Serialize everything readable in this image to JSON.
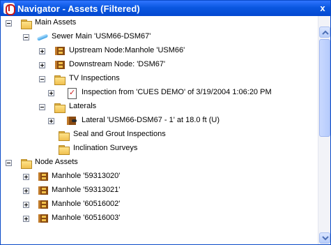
{
  "window": {
    "title": "Navigator - Assets (Filtered)",
    "close_glyph": "x"
  },
  "tree": {
    "main_assets": "Main Assets",
    "sewer_main": "Sewer Main 'USM66-DSM67'",
    "upstream_node": "Upstream Node:Manhole 'USM66'",
    "downstream_node": "Downstream Node: 'DSM67'",
    "tv_inspections": "TV Inspections",
    "inspection_item": "Inspection from 'CUES DEMO' of 3/19/2004 1:06:20 PM",
    "laterals": "Laterals",
    "lateral_item": "Lateral 'USM66-DSM67 - 1' at 18.0 ft (U)",
    "seal_grout": "Seal and Grout Inspections",
    "inclination": "Inclination Surveys",
    "node_assets": "Node Assets",
    "manholes": [
      "Manhole '59313020'",
      "Manhole '59313021'",
      "Manhole '60516002'",
      "Manhole '60516003'"
    ]
  },
  "colors": {
    "titlebar": "#0a57e0",
    "folder": "#f0c050",
    "scrollbar_thumb": "#b5cafc"
  }
}
